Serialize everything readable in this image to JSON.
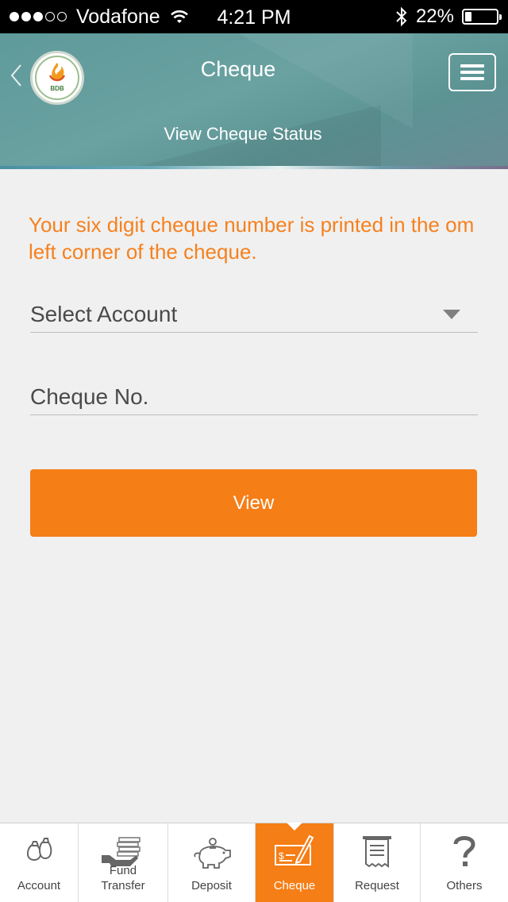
{
  "status_bar": {
    "carrier": "Vodafone",
    "time": "4:21 PM",
    "battery_percent": "22%",
    "battery_level": 0.22,
    "signal_bars": 3,
    "signal_total": 5
  },
  "header": {
    "title": "Cheque",
    "subtitle": "View Cheque Status",
    "logo_text": "BDB"
  },
  "form": {
    "hint": "Your six digit cheque number is printed in the om left corner of the cheque.",
    "account_select": "Select Account",
    "cheque_placeholder": "Cheque No.",
    "view_button": "View"
  },
  "tabs": [
    {
      "label": "Account",
      "icon": "money-bags-icon",
      "active": false
    },
    {
      "label": "Fund\nTransfer",
      "icon": "coins-hand-icon",
      "active": false
    },
    {
      "label": "Deposit",
      "icon": "piggy-bank-icon",
      "active": false
    },
    {
      "label": "Cheque",
      "icon": "cheque-pen-icon",
      "active": true
    },
    {
      "label": "Request",
      "icon": "receipt-icon",
      "active": false
    },
    {
      "label": "Others",
      "icon": "question-mark-icon",
      "active": false
    }
  ],
  "colors": {
    "accent": "#f57e16",
    "header": "#5f9a9a",
    "hint_text": "#f5811f"
  }
}
